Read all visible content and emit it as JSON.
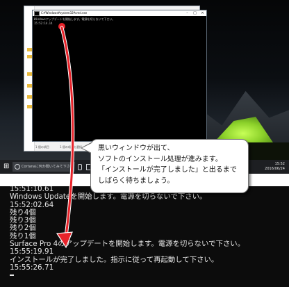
{
  "explorer": {
    "status_items": [
      "1 個の項目",
      "1 個の項目を選択",
      "14 KB"
    ]
  },
  "cmd_window": {
    "title": "C:¥Windows¥system32¥cmd.exe",
    "controls": [
      "–",
      "□",
      "×"
    ],
    "lines": [
      "Windowsアップデートを開始します。電源を切らないで下さい。",
      "15:52:14.14"
    ]
  },
  "taskbar": {
    "search_placeholder": "Cortanaに何か聞いてみて下さい",
    "time": "15:52",
    "date": "2016/06/24"
  },
  "callout": {
    "lines": [
      "黒いウィンドウが出て、",
      "ソフトのインストール処理が進みます。",
      "「インストールが完了しました」と出るまで",
      "しばらく待ちましょう。"
    ]
  },
  "console": {
    "lines": [
      "15:51:10.61",
      "Windows Updateを開始します。電源を切らないで下さい。",
      "15:52:02.64",
      "残り4個",
      "残り3個",
      "残り2個",
      "残り1個",
      "Surface Pro 4のアップデートを開始します。電源を切らないで下さい。",
      "15:55:19.91",
      "インストールが完了しました。指示に従って再起動して下さい。",
      "15:55:26.71"
    ]
  },
  "colors": {
    "arrow": "#e8232a",
    "console_bg": "#0c0c0c",
    "console_text": "#e6e6e6"
  },
  "icons": [
    "windows-start-icon",
    "search-icon",
    "microphone-icon",
    "task-view-icon",
    "cmd-app-icon",
    "red-arrow-icon"
  ]
}
